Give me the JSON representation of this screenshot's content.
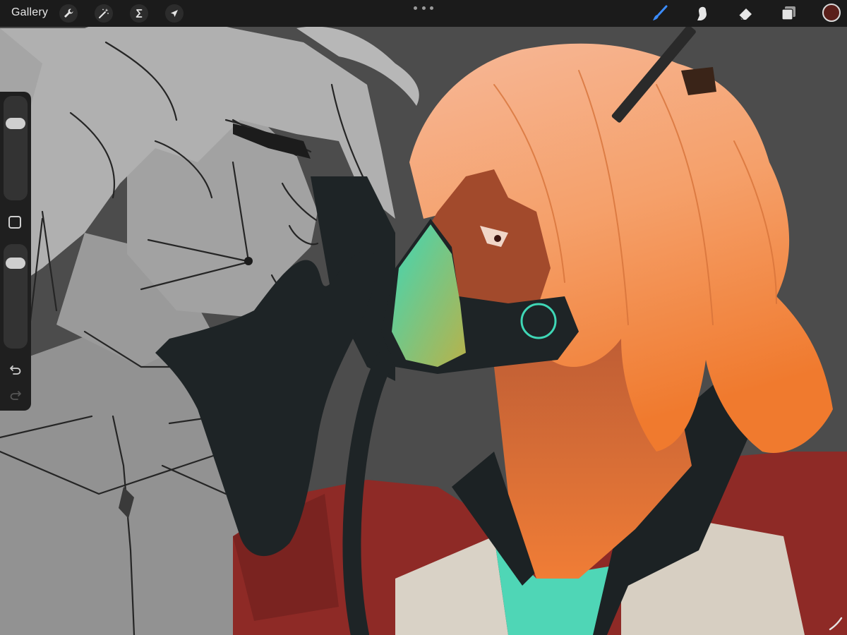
{
  "toolbar": {
    "gallery_label": "Gallery",
    "left_tools": [
      {
        "name": "actions",
        "icon": "wrench-icon"
      },
      {
        "name": "adjustments",
        "icon": "magic-wand-icon"
      },
      {
        "name": "selection",
        "icon": "selection-s-icon"
      },
      {
        "name": "transform",
        "icon": "arrow-cursor-icon"
      }
    ],
    "right_tools": [
      {
        "name": "brush",
        "icon": "brush-icon",
        "active": true
      },
      {
        "name": "smudge",
        "icon": "smudge-finger-icon",
        "active": false
      },
      {
        "name": "eraser",
        "icon": "eraser-icon",
        "active": false
      },
      {
        "name": "layers",
        "icon": "layers-icon",
        "active": false
      }
    ],
    "current_color": "#5a1f1a",
    "active_tool_color": "#3b8cff"
  },
  "sidebar": {
    "brush_size_level": 0.22,
    "opacity_level": 0.88,
    "modify_icon": "square-outline-icon",
    "undo_icon": "undo-icon",
    "redo_icon": "redo-icon"
  },
  "canvas": {
    "background_color": "#4c4c4c",
    "palette": {
      "hair": "#f39a5c",
      "skin": "#d9693a",
      "jacket_red": "#8e2a26",
      "shirt_teal": "#4fd6b6",
      "glove": "#1e2426",
      "sketch_gray": "#8e8e8e"
    }
  }
}
